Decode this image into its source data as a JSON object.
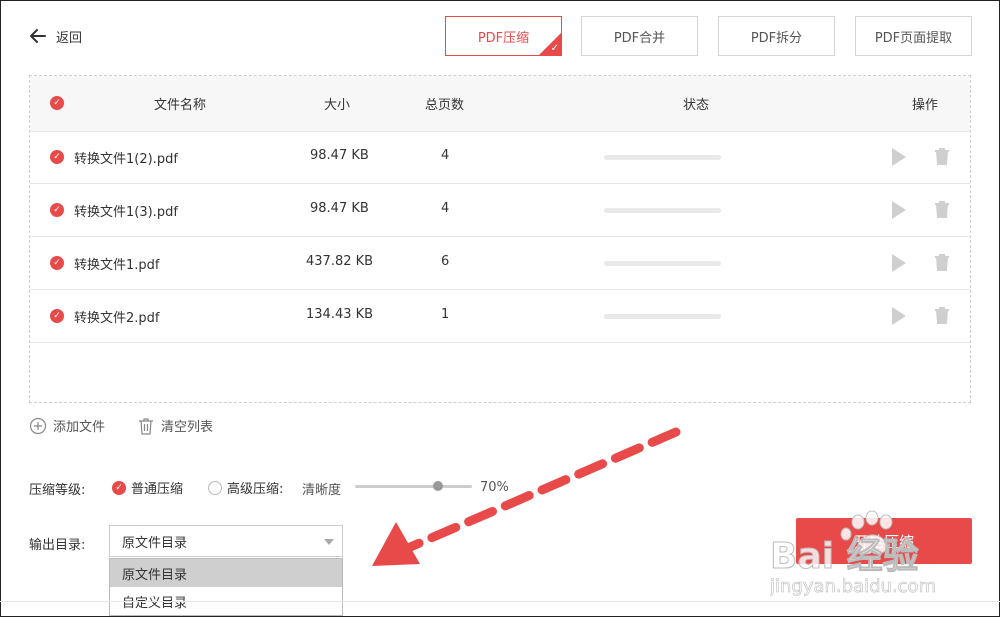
{
  "back_label": "返回",
  "tabs": [
    {
      "label": "PDF压缩",
      "active": true
    },
    {
      "label": "PDF合并",
      "active": false
    },
    {
      "label": "PDF拆分",
      "active": false
    },
    {
      "label": "PDF页面提取",
      "active": false
    }
  ],
  "table": {
    "headers": {
      "name": "文件名称",
      "size": "大小",
      "pages": "总页数",
      "status": "状态",
      "actions": "操作"
    },
    "rows": [
      {
        "name": "转换文件1(2).pdf",
        "size": "98.47 KB",
        "pages": "4",
        "progress": 0
      },
      {
        "name": "转换文件1(3).pdf",
        "size": "98.47 KB",
        "pages": "4",
        "progress": 0
      },
      {
        "name": "转换文件1.pdf",
        "size": "437.82 KB",
        "pages": "6",
        "progress": 0
      },
      {
        "name": "转换文件2.pdf",
        "size": "134.43 KB",
        "pages": "1",
        "progress": 0
      }
    ]
  },
  "actions": {
    "add_file": "添加文件",
    "clear_list": "清空列表"
  },
  "compression": {
    "label": "压缩等级:",
    "normal": "普通压缩",
    "advanced": "高级压缩:",
    "clarity_label": "清晰度",
    "clarity_value": "70%",
    "selected": "normal"
  },
  "output": {
    "label": "输出目录:",
    "selected": "原文件目录",
    "options": [
      "原文件目录",
      "自定义目录"
    ]
  },
  "start_button": "开始压缩",
  "watermark": {
    "logo": "Bai 经验",
    "url": "jingyan.baidu.com"
  },
  "colors": {
    "accent": "#e84a4a",
    "annotation_arrow": "#e84a4a"
  },
  "icons": [
    "arrow-left-icon",
    "check-icon",
    "play-icon",
    "trash-icon",
    "plus-circle-icon",
    "paw-icon",
    "chevron-down-icon"
  ]
}
